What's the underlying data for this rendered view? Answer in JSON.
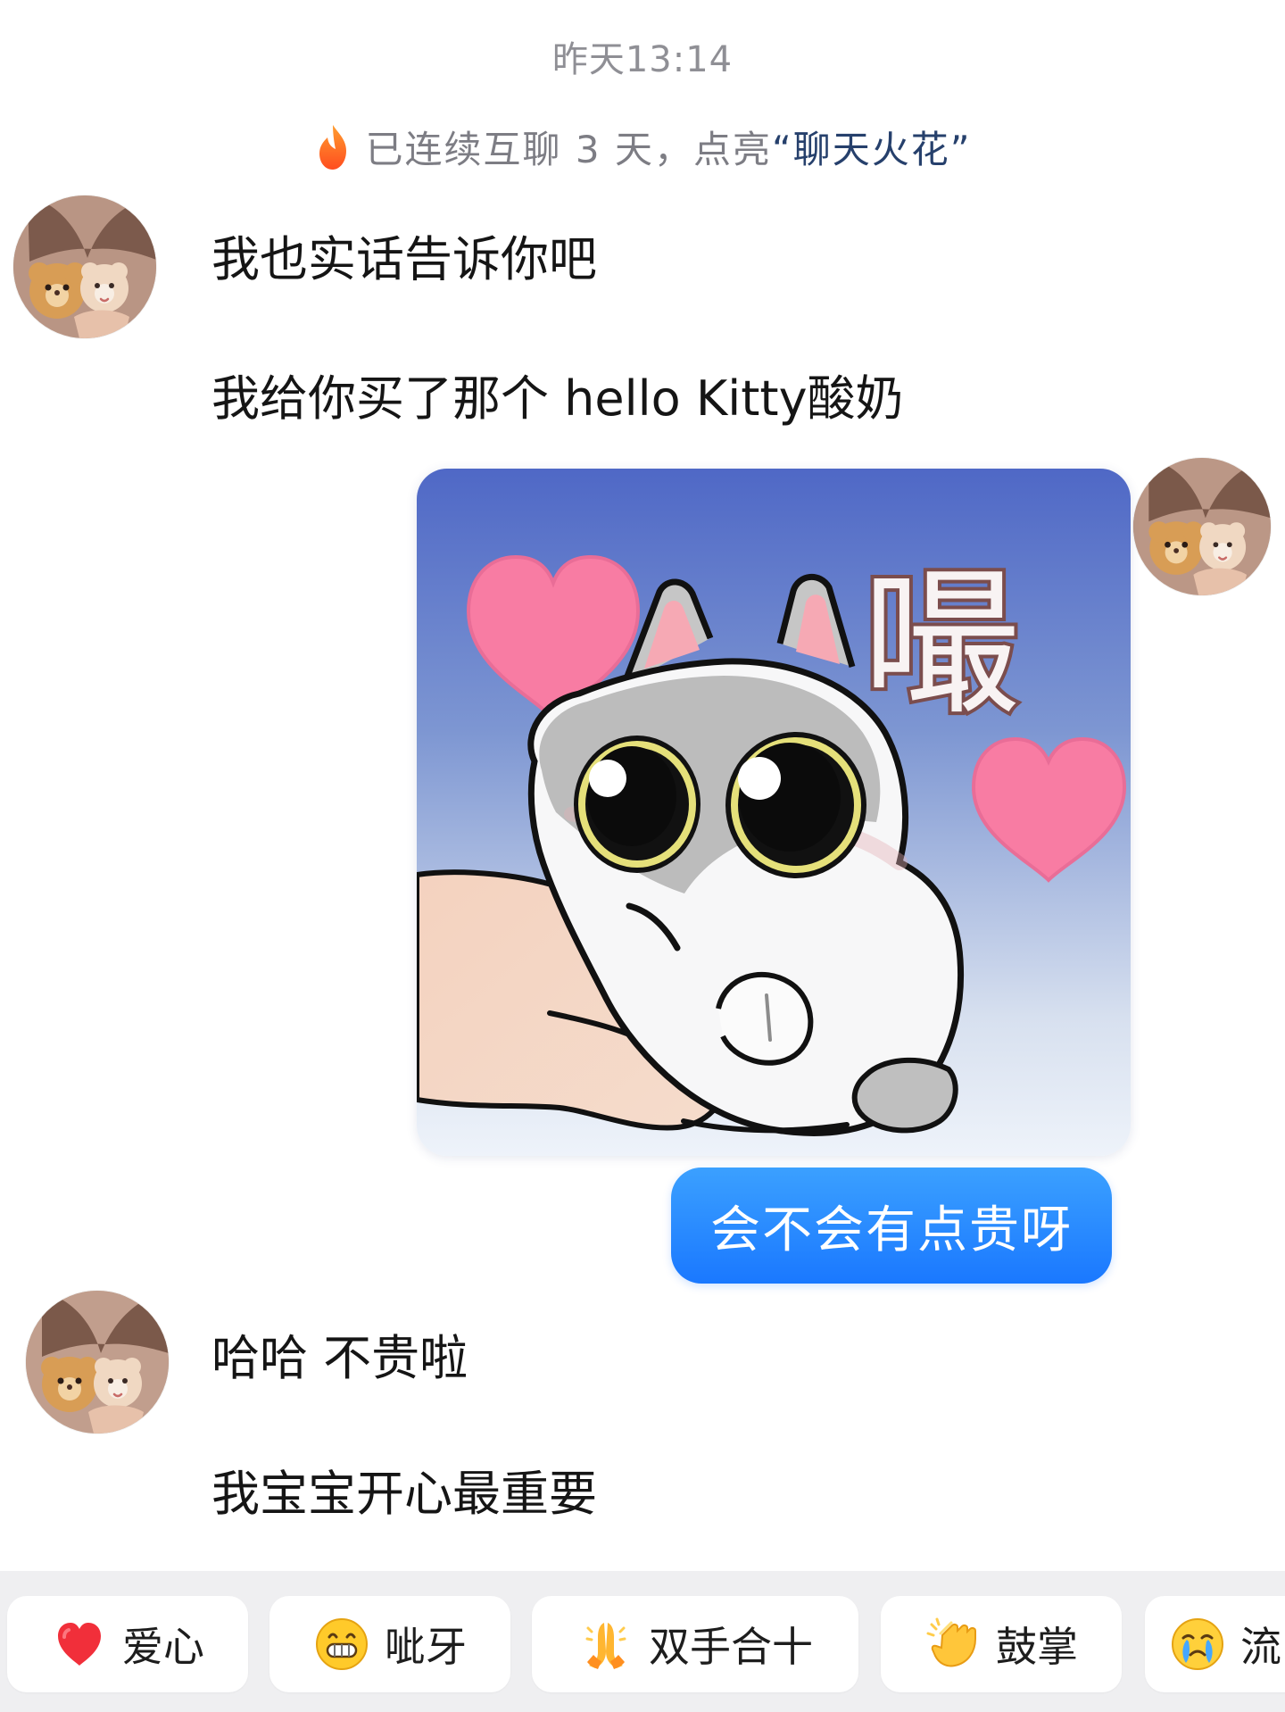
{
  "chat": {
    "timestamp": "昨天13:14",
    "streak": {
      "prefix": "已连续互聊 3 天，点亮",
      "link": "“聊天火花”"
    },
    "messages": [
      {
        "text": "我也实话告诉你吧"
      },
      {
        "text": "我给你买了那个 hello Kitty酸奶"
      },
      {
        "sticker_text": "嘬"
      },
      {
        "text": "会不会有点贵呀"
      },
      {
        "text": "哈哈 不贵啦"
      },
      {
        "text": "我宝宝开心最重要"
      }
    ]
  },
  "reactions": [
    {
      "label": "爱心",
      "icon": "heart-icon"
    },
    {
      "label": "呲牙",
      "icon": "grin-icon"
    },
    {
      "label": "双手合十",
      "icon": "folded-hands-icon"
    },
    {
      "label": "鼓掌",
      "icon": "clap-icon"
    },
    {
      "label": "流",
      "icon": "tear-icon"
    }
  ]
}
